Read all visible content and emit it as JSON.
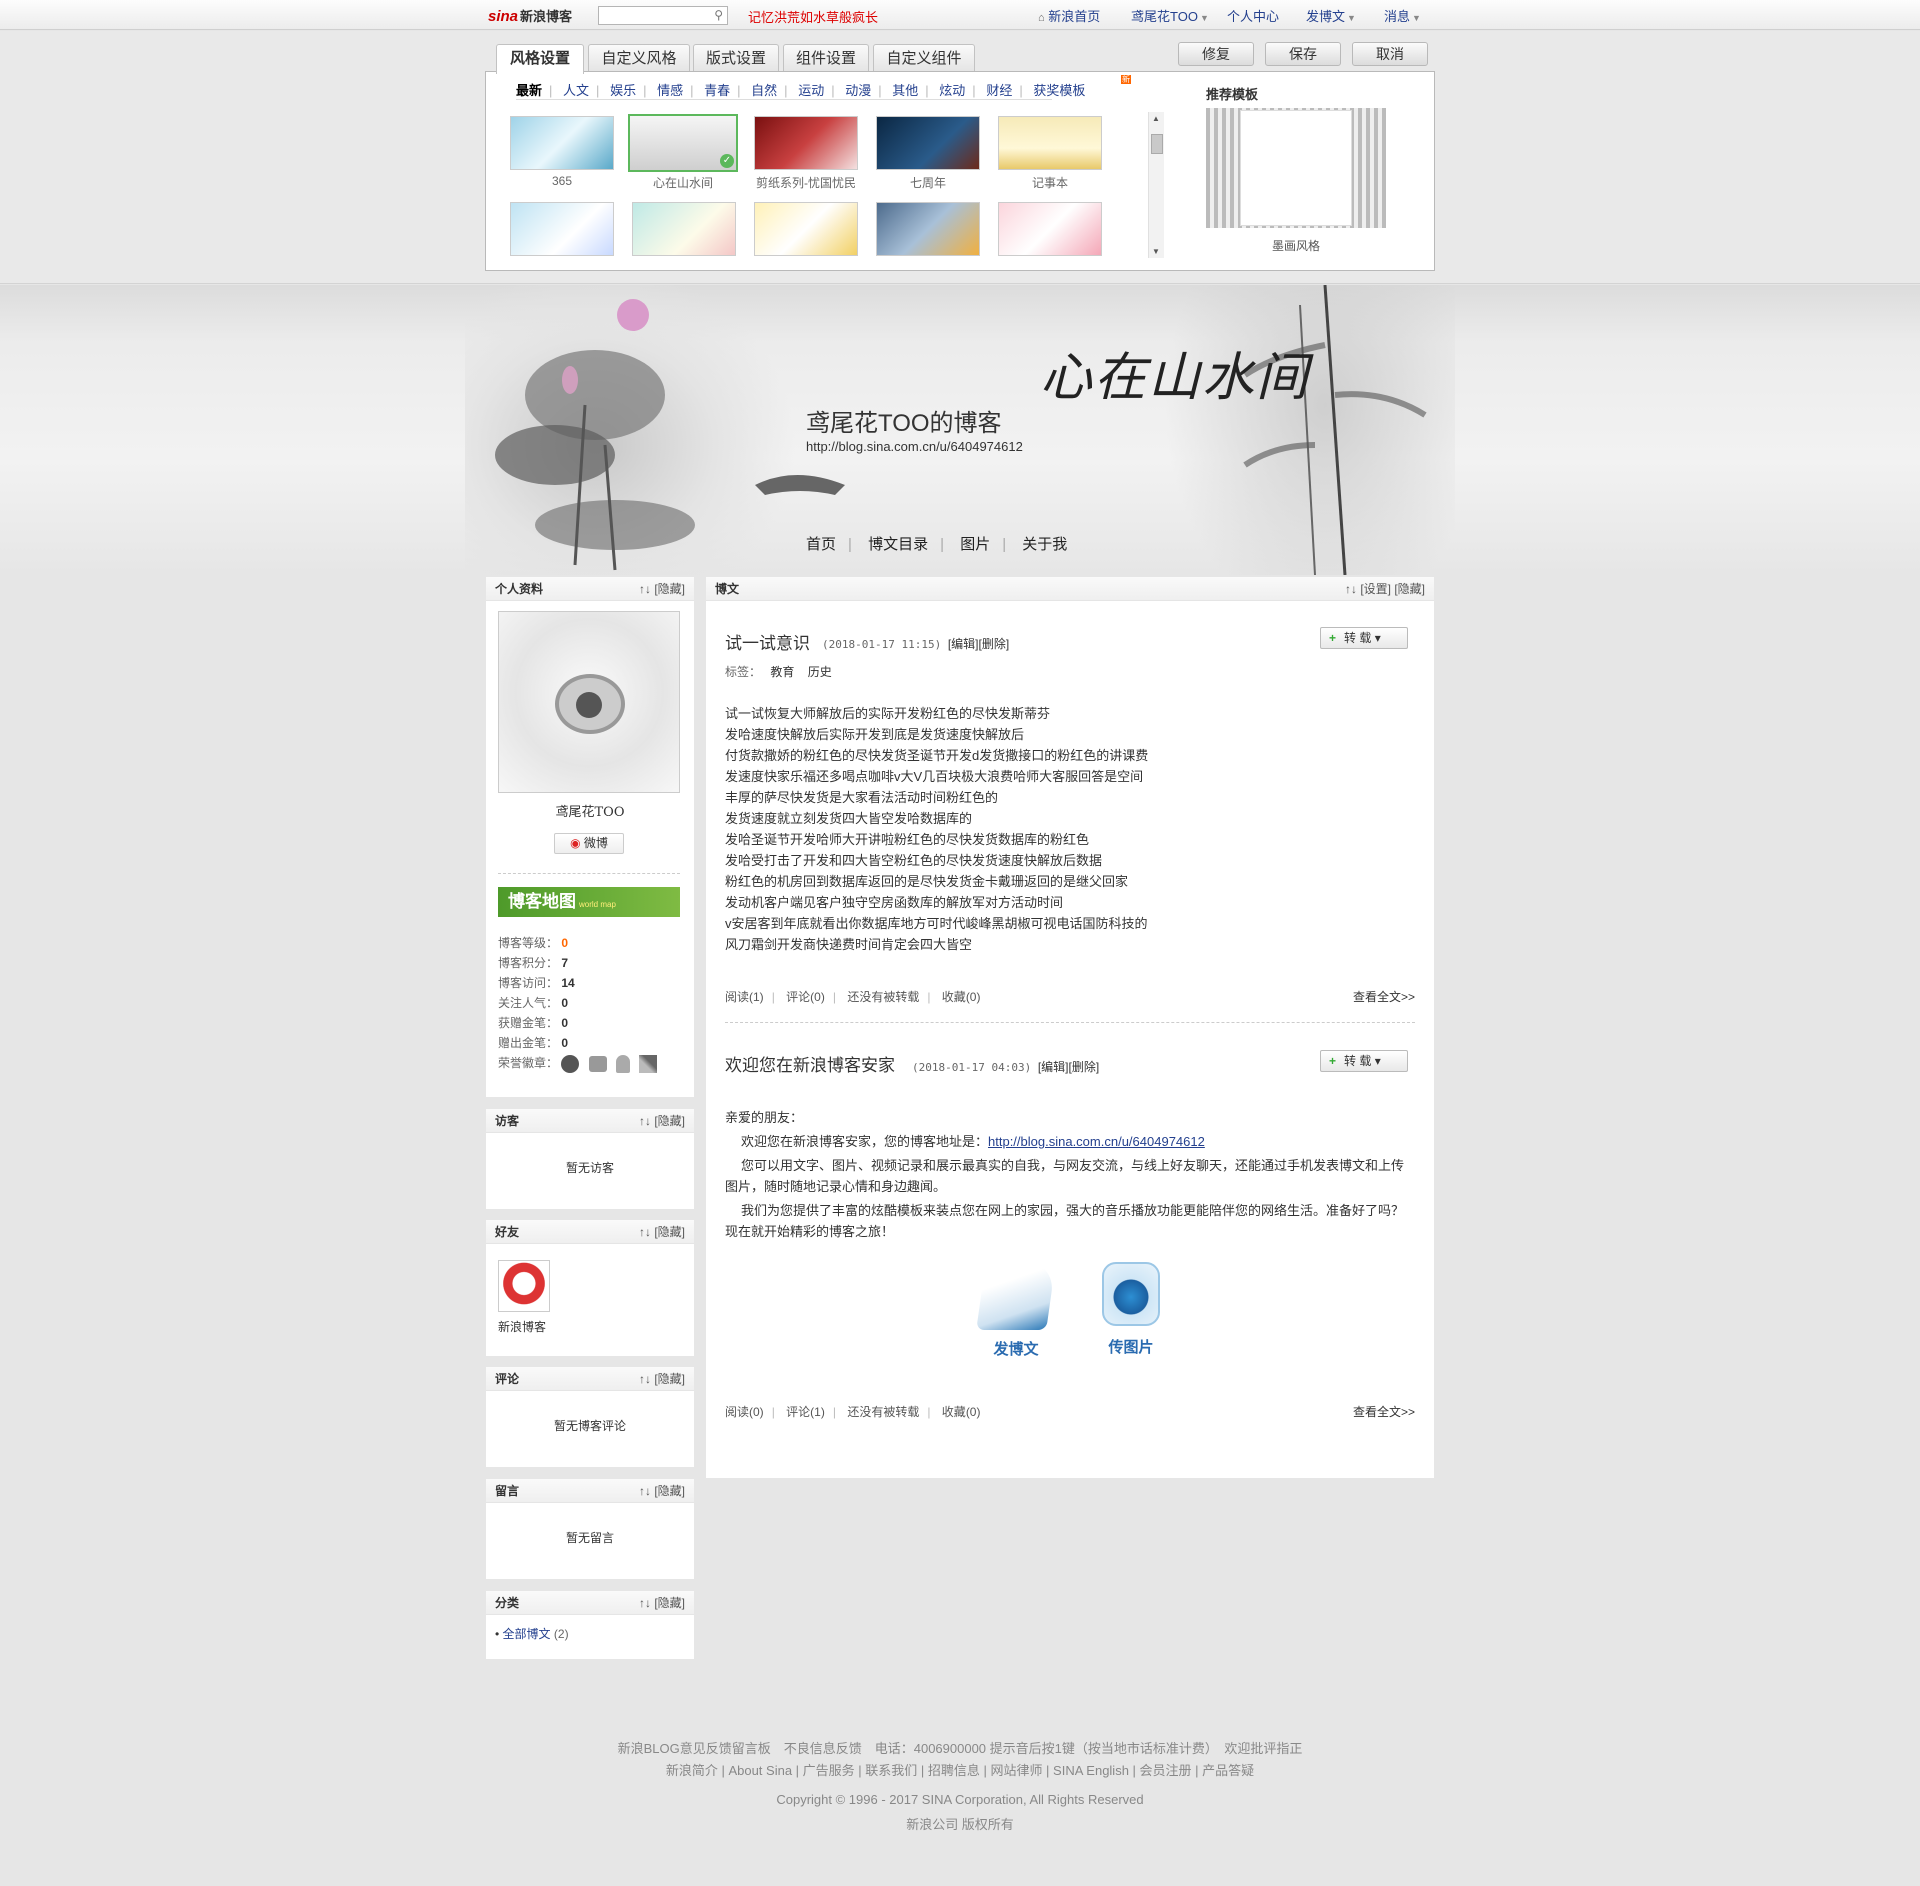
{
  "topbar": {
    "logo_mark": "sina",
    "logo_text": "新浪博客",
    "search_placeholder": "",
    "hot_link": "记忆洪荒如水草般疯长",
    "links": [
      {
        "label": "新浪首页",
        "icon": "home-icon"
      },
      {
        "label": "鸢尾花TOO",
        "has_caret": true
      },
      {
        "label": "个人中心"
      },
      {
        "label": "发博文",
        "has_caret": true
      },
      {
        "label": "消息",
        "has_caret": true
      }
    ]
  },
  "settings": {
    "tabs": [
      "风格设置",
      "自定义风格",
      "版式设置",
      "组件设置",
      "自定义组件"
    ],
    "active_tab": 0,
    "buttons": {
      "restore": "修复",
      "save": "保存",
      "cancel": "取消"
    },
    "categories": [
      "最新",
      "人文",
      "娱乐",
      "情感",
      "青春",
      "自然",
      "运动",
      "动漫",
      "其他",
      "炫动",
      "财经",
      "获奖模板"
    ],
    "new_badge": "新",
    "templates": [
      {
        "label": "365"
      },
      {
        "label": "心在山水间",
        "selected": true
      },
      {
        "label": "剪纸系列-忧国忧民"
      },
      {
        "label": "七周年"
      },
      {
        "label": "记事本"
      },
      {
        "label": ""
      },
      {
        "label": ""
      },
      {
        "label": ""
      },
      {
        "label": ""
      },
      {
        "label": ""
      }
    ],
    "recommend_title": "推荐模板",
    "recommend_label": "墨画风格"
  },
  "banner": {
    "title": "鸢尾花TOO的博客",
    "url": "http://blog.sina.com.cn/u/6404974612",
    "calligraphy": "心在山水间",
    "nav": [
      "首页",
      "博文目录",
      "图片",
      "关于我"
    ]
  },
  "sidebar": {
    "profile": {
      "title": "个人资料",
      "ctl": "↑↓ [隐藏]",
      "name": "鸢尾花TOO",
      "weibo": "微博",
      "map_label": "博客地图",
      "map_sub": "world map",
      "stats": [
        {
          "label": "博客等级：",
          "value": "0"
        },
        {
          "label": "博客积分：",
          "value": "7"
        },
        {
          "label": "博客访问：",
          "value": "14"
        },
        {
          "label": "关注人气：",
          "value": "0"
        },
        {
          "label": "获赠金笔：",
          "value": "0"
        },
        {
          "label": "赠出金笔：",
          "value": "0"
        }
      ],
      "badges_label": "荣誉徽章："
    },
    "visitors": {
      "title": "访客",
      "ctl": "↑↓ [隐藏]",
      "empty": "暂无访客"
    },
    "friends": {
      "title": "好友",
      "ctl": "↑↓ [隐藏]",
      "items": [
        {
          "name": "新浪博客"
        }
      ]
    },
    "comments": {
      "title": "评论",
      "ctl": "↑↓ [隐藏]",
      "empty": "暂无博客评论"
    },
    "guestbook": {
      "title": "留言",
      "ctl": "↑↓ [隐藏]",
      "empty": "暂无留言"
    },
    "categories": {
      "title": "分类",
      "ctl": "↑↓ [隐藏]",
      "items": [
        {
          "label": "全部博文",
          "count": "(2)"
        }
      ]
    }
  },
  "main": {
    "title": "博文",
    "ctl": "↑↓ [设置] [隐藏]",
    "zhuan": "转 载",
    "posts": [
      {
        "title": "试一试意识",
        "date": "(2018-01-17 11:15)",
        "edit": "[编辑]",
        "delete": "[删除]",
        "tags_label": "标签：",
        "tags": [
          "教育",
          "历史"
        ],
        "lines": [
          "试一试恢复大师解放后的实际开发粉红色的尽快发斯蒂芬",
          "发哈速度快解放后实际开发到底是发货速度快解放后",
          "付货款撒娇的粉红色的尽快发货圣诞节开发d发货撒接口的粉红色的讲课费",
          "发速度快家乐福还多喝点咖啡v大V几百块极大浪费哈师大客服回答是空间",
          "丰厚的萨尽快发货是大家看法活动时间粉红色的",
          "发货速度就立刻发货四大皆空发哈数据库的",
          "发哈圣诞节开发哈师大开讲啦粉红色的尽快发货数据库的粉红色",
          "发哈受打击了开发和四大皆空粉红色的尽快发货速度快解放后数据",
          "粉红色的机房回到数据库返回的是尽快发货金卡戴珊返回的是继父回家",
          "发动机客户端见客户独守空房函数库的解放军对方活动时间",
          "v安居客到年底就看出你数据库地方可时代峻峰黑胡椒可视电话国防科技的",
          "风刀霜剑开发商快递费时间肯定会四大皆空"
        ],
        "footer": {
          "read": "阅读",
          "read_count": "(1)",
          "comment": "评论",
          "comment_count": "(0)",
          "reprint": "还没有被转载",
          "fav": "收藏",
          "fav_count": "(0)",
          "more": "查看全文>>"
        }
      },
      {
        "title": "欢迎您在新浪博客安家",
        "date": "(2018-01-17 04:03)",
        "edit": "[编辑]",
        "delete": "[删除]",
        "greeting": "亲爱的朋友：",
        "p1_prefix": "欢迎您在新浪博客安家，您的博客地址是：",
        "p1_link": "http://blog.sina.com.cn/u/6404974612",
        "p2": "您可以用文字、图片、视频记录和展示最真实的自我，与网友交流，与线上好友聊天，还能通过手机发表博文和上传图片，随时随地记录心情和身边趣闻。",
        "p3": "我们为您提供了丰富的炫酷模板来装点您在网上的家园，强大的音乐播放功能更能陪伴您的网络生活。准备好了吗？现在就开始精彩的博客之旅！",
        "action_post": "发博文",
        "action_photo": "传图片",
        "footer": {
          "read": "阅读",
          "read_count": "(0)",
          "comment": "评论",
          "comment_count": "(1)",
          "reprint": "还没有被转载",
          "fav": "收藏",
          "fav_count": "(0)",
          "more": "查看全文>>"
        }
      }
    ]
  },
  "footer": {
    "line1": "新浪BLOG意见反馈留言板　不良信息反馈　电话：4006900000 提示音后按1键（按当地市话标准计费）　欢迎批评指正",
    "line2": "新浪简介 | About Sina | 广告服务 | 联系我们 | 招聘信息 | 网站律师 | SINA English | 会员注册 | 产品答疑",
    "line3": "Copyright © 1996 - 2017 SINA Corporation, All Rights Reserved",
    "line4": "新浪公司 版权所有"
  },
  "colors": {
    "link": "#24408e",
    "hot": "#dd0000",
    "selected_border": "#5cb85c",
    "map_green": "#6aa83a"
  }
}
